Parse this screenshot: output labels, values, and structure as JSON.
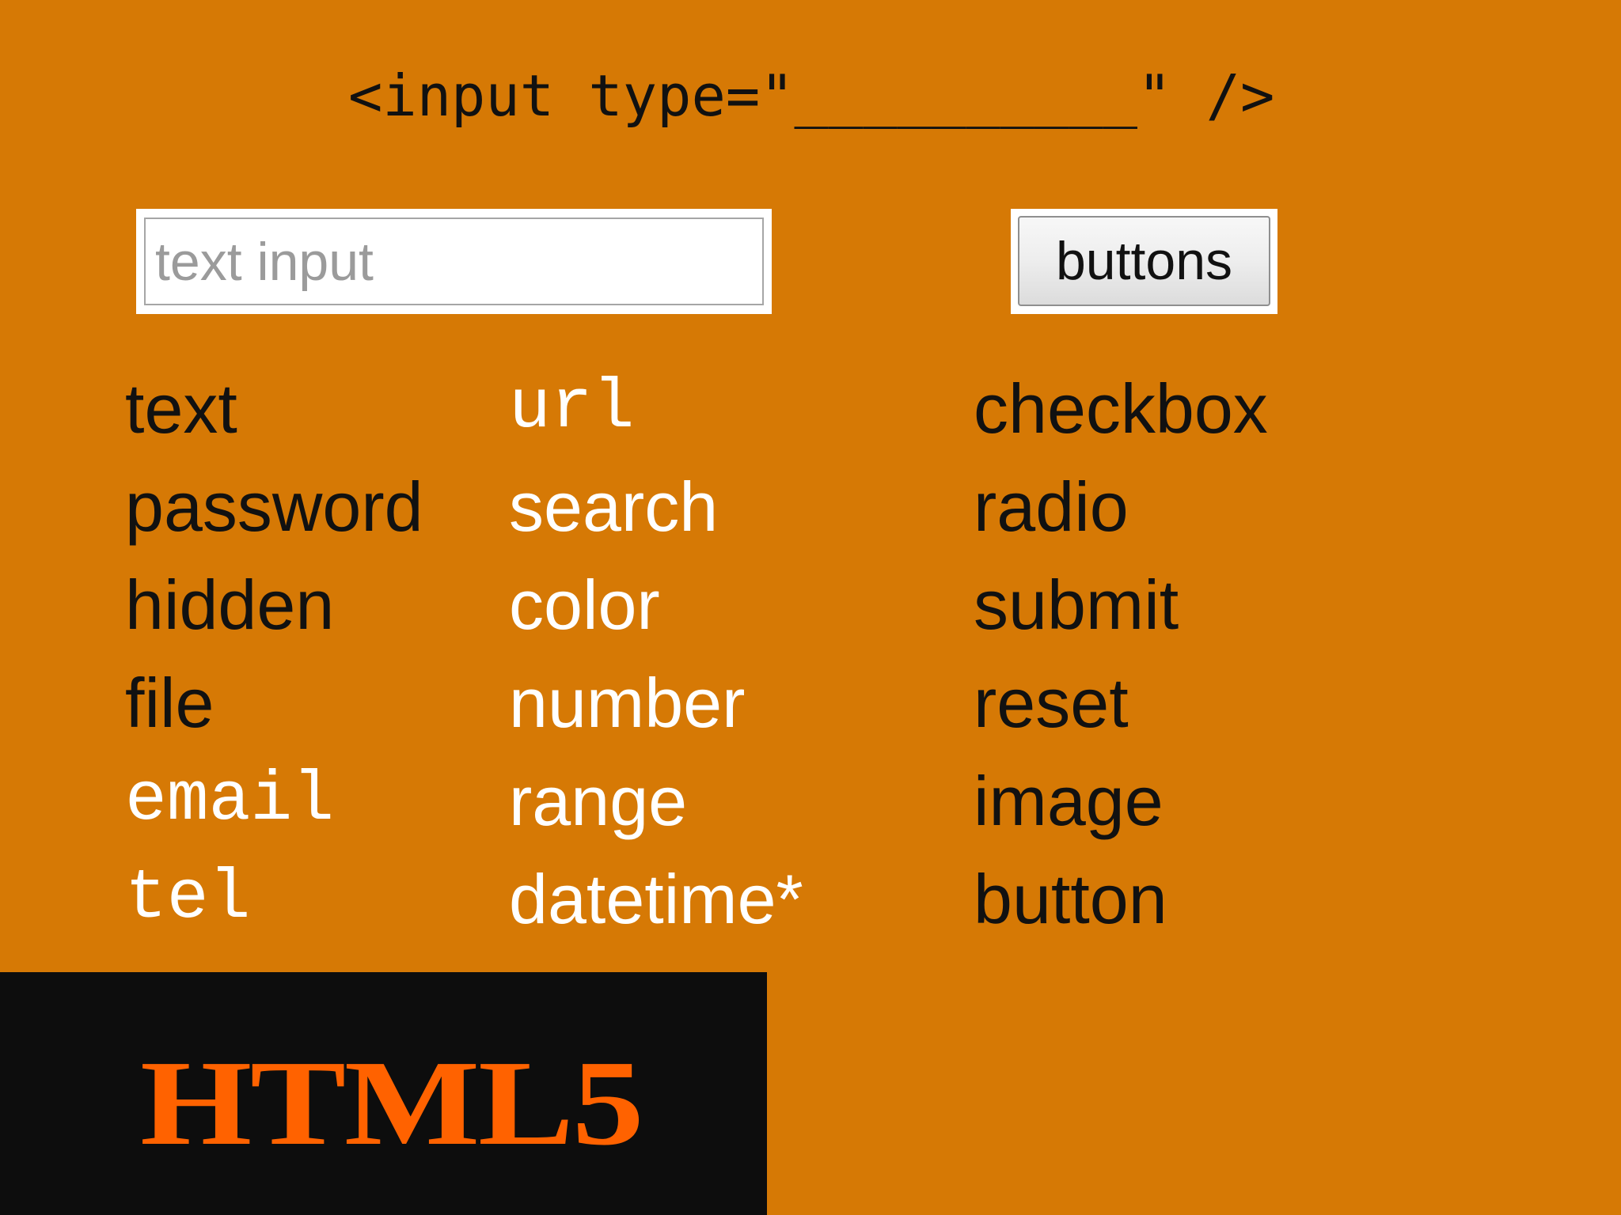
{
  "header": {
    "code_text": "<input type=\"__________\" />"
  },
  "demo": {
    "text_input_placeholder": "text input",
    "button_label": "buttons"
  },
  "types": {
    "column_1": [
      {
        "label": "text",
        "tone": "dark",
        "font": "sans"
      },
      {
        "label": "password",
        "tone": "dark",
        "font": "sans"
      },
      {
        "label": "hidden",
        "tone": "dark",
        "font": "sans"
      },
      {
        "label": "file",
        "tone": "dark",
        "font": "sans"
      },
      {
        "label": "email",
        "tone": "light",
        "font": "mono"
      },
      {
        "label": "tel",
        "tone": "light",
        "font": "mono"
      }
    ],
    "column_2": [
      {
        "label": "url",
        "tone": "light",
        "font": "mono"
      },
      {
        "label": "search",
        "tone": "light",
        "font": "sans"
      },
      {
        "label": "color",
        "tone": "light",
        "font": "sans"
      },
      {
        "label": "number",
        "tone": "light",
        "font": "sans"
      },
      {
        "label": "range",
        "tone": "light",
        "font": "sans"
      },
      {
        "label": "datetime*",
        "tone": "light",
        "font": "sans"
      }
    ],
    "column_3": [
      {
        "label": "checkbox",
        "tone": "dark",
        "font": "sans"
      },
      {
        "label": "radio",
        "tone": "dark",
        "font": "sans"
      },
      {
        "label": "submit",
        "tone": "dark",
        "font": "sans"
      },
      {
        "label": "reset",
        "tone": "dark",
        "font": "sans"
      },
      {
        "label": "image",
        "tone": "dark",
        "font": "sans"
      },
      {
        "label": "button",
        "tone": "dark",
        "font": "sans"
      }
    ]
  },
  "brand": {
    "logo_text": "HTML5"
  },
  "colors": {
    "background": "#d67905",
    "dark_text": "#111111",
    "light_text": "#ffffff",
    "brand_box": "#0d0d0d",
    "brand_text": "#ff6200",
    "input_border": "#a6a6a6",
    "button_border": "#8f8f8f"
  }
}
